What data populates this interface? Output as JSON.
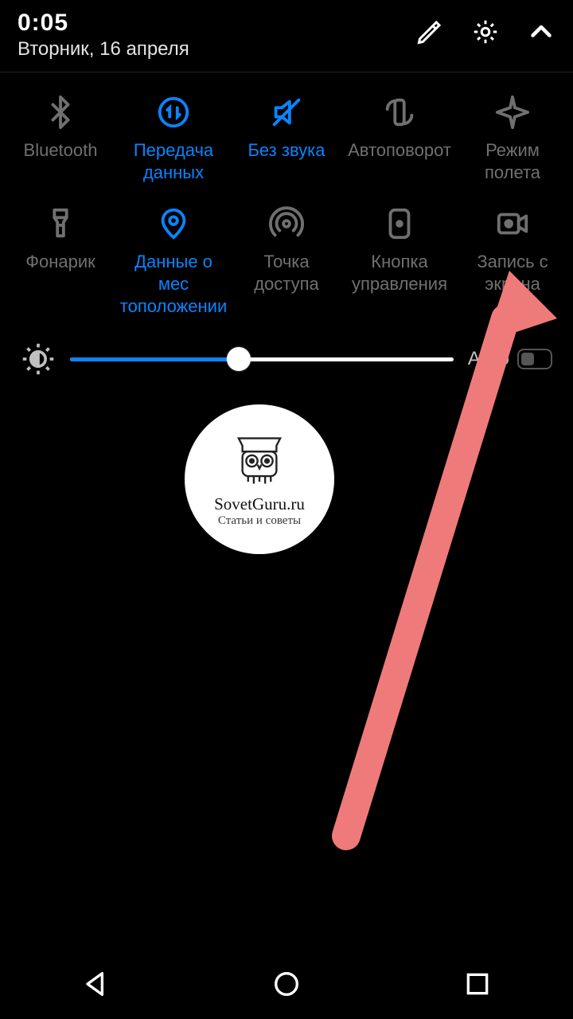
{
  "header": {
    "time": "0:05",
    "date": "Вторник, 16 апреля"
  },
  "tiles": {
    "row1": [
      {
        "name": "bluetooth",
        "label": "Bluetooth",
        "icon": "bluetooth-icon",
        "active": false
      },
      {
        "name": "data",
        "label": "Передача\nданных",
        "icon": "data-transfer-icon",
        "active": true
      },
      {
        "name": "mute",
        "label": "Без звука",
        "icon": "mute-icon",
        "active": true
      },
      {
        "name": "rotate",
        "label": "Автоповорот",
        "icon": "auto-rotate-icon",
        "active": false
      },
      {
        "name": "airplane",
        "label": "Режим полета",
        "icon": "airplane-icon",
        "active": false
      }
    ],
    "row2": [
      {
        "name": "flashlight",
        "label": "Фонарик",
        "icon": "flashlight-icon",
        "active": false
      },
      {
        "name": "location",
        "label": "Данные о мес\nтоположении",
        "icon": "location-icon",
        "active": true
      },
      {
        "name": "hotspot",
        "label": "Точка доступа",
        "icon": "hotspot-icon",
        "active": false
      },
      {
        "name": "control",
        "label": "Кнопка\nуправления",
        "icon": "control-button-icon",
        "active": false
      },
      {
        "name": "screenrec",
        "label": "Запись с\nэкрана",
        "icon": "screen-record-icon",
        "active": false
      }
    ]
  },
  "brightness": {
    "percent": 44,
    "auto_label": "Авто",
    "auto_on": false
  },
  "badge": {
    "line1": "SovetGuru.ru",
    "line2": "Статьи и советы"
  },
  "colors": {
    "accent": "#0a84ff",
    "inactive": "#707070",
    "arrow": "#ef7a7a"
  }
}
